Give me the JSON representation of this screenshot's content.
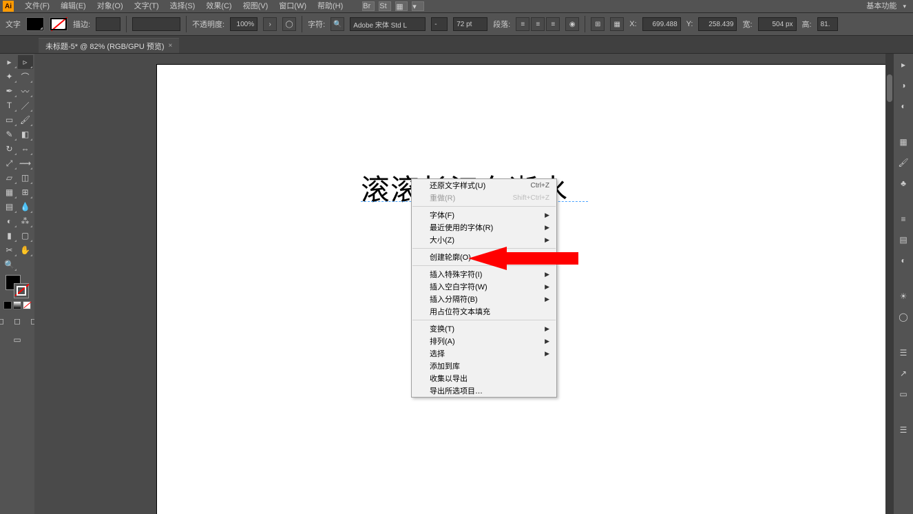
{
  "app_icon": "Ai",
  "menus": {
    "file": "文件(F)",
    "edit": "编辑(E)",
    "object": "对象(O)",
    "type": "文字(T)",
    "select": "选择(S)",
    "effect": "效果(C)",
    "view": "视图(V)",
    "window": "窗口(W)",
    "help": "帮助(H)"
  },
  "workspace_label": "基本功能",
  "control": {
    "tool_label": "文字",
    "stroke_label": "描边:",
    "stroke_weight": "",
    "opacity_label": "不透明度:",
    "opacity_value": "100%",
    "char_label": "字符:",
    "font_name": "Adobe 宋体 Std L",
    "font_style": "-",
    "font_size": "72 pt",
    "para_label": "段落:",
    "x_label": "X:",
    "x_val": "699.488",
    "y_label": "Y:",
    "y_val": "258.439",
    "w_label": "宽:",
    "w_val": "504 px",
    "h_label": "高:",
    "h_val": "81."
  },
  "tab": {
    "title": "未标题-5* @ 82% (RGB/GPU 预览)",
    "close": "×"
  },
  "artboard_text": "滚滚长江东逝水",
  "context_menu": {
    "undo": "还原文字样式(U)",
    "undo_sc": "Ctrl+Z",
    "redo": "重做(R)",
    "redo_sc": "Shift+Ctrl+Z",
    "font": "字体(F)",
    "recent_fonts": "最近使用的字体(R)",
    "size": "大小(Z)",
    "create_outlines": "创建轮廓(O)",
    "insert_special": "插入特殊字符(I)",
    "insert_blank": "插入空白字符(W)",
    "insert_break": "插入分隔符(B)",
    "fill_placeholder": "用占位符文本填充",
    "transform": "变换(T)",
    "arrange": "排列(A)",
    "select": "选择",
    "add_to_lib": "添加到库",
    "collect_export": "收集以导出",
    "export_selection": "导出所选项目…"
  }
}
